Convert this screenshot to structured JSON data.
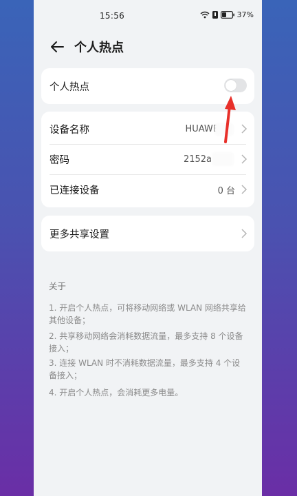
{
  "status": {
    "time": "15:56",
    "battery": "37%"
  },
  "header": {
    "title": "个人热点"
  },
  "hotspot": {
    "label": "个人热点",
    "enabled": false
  },
  "settings": {
    "device_name_label": "设备名称",
    "device_name_value": "HUAWE",
    "password_label": "密码",
    "password_value": "2152a",
    "connected_label": "已连接设备",
    "connected_value": "0 台"
  },
  "more": {
    "label": "更多共享设置"
  },
  "about": {
    "title": "关于",
    "item1": "1. 开启个人热点，可将移动网络或 WLAN 网络共享给其他设备；",
    "item2": "2. 共享移动网络会消耗数据流量，最多支持 8 个设备接入；",
    "item3": "3. 连接 WLAN 时不消耗数据流量，最多支持 4 个设备接入；",
    "item4": "4. 开启个人热点，会消耗更多电量。"
  },
  "icons": [
    "wifi-icon",
    "sim-icon",
    "battery-icon",
    "back-arrow-icon",
    "chevron-right-icon"
  ],
  "colors": {
    "annotation_arrow": "#e8302a"
  }
}
